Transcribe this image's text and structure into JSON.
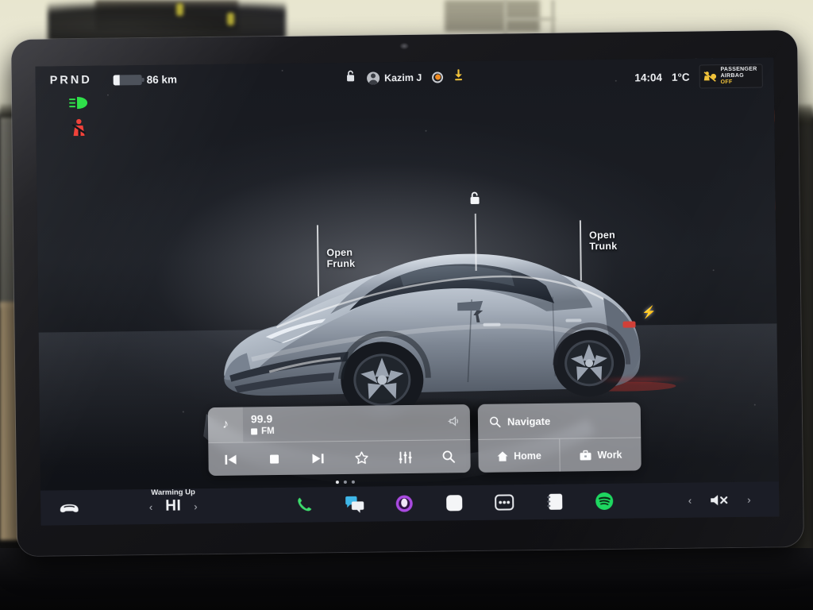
{
  "status_bar": {
    "gear_indicator": "PRND",
    "gear_active": "D",
    "range": "86 km",
    "battery_level_percent": 22,
    "telltales": [
      {
        "name": "low-beam-headlight",
        "color": "#2fe04a"
      },
      {
        "name": "seatbelt-reminder",
        "color": "#f0423a"
      }
    ],
    "lock_icon": "unlocked-padlock",
    "profile_name": "Kazim J",
    "dashcam_icon": "dashcam-record",
    "download_icon": "software-update-download",
    "clock": "14:04",
    "outside_temp": "1°C",
    "airbag": {
      "line1": "PASSENGER",
      "line2": "AIRBAG",
      "state": "OFF"
    }
  },
  "vehicle_view": {
    "callouts": [
      {
        "label": "Open\nFrunk",
        "name": "open-frunk"
      },
      {
        "label": "Open\nTrunk",
        "name": "open-trunk"
      }
    ],
    "lock_pin": "unlocked-padlock",
    "charge_port_icon": "charge-bolt",
    "model": "Tesla Model 3"
  },
  "map": {
    "position_marker": "navigation-arrow",
    "alert_markers": [
      "speed-alert",
      "speed-alert"
    ]
  },
  "media_card": {
    "source_icon": "music-note",
    "station": "99.9",
    "band": "FM",
    "volume_icon": "speaker",
    "controls": [
      {
        "name": "previous-track",
        "glyph": "previous"
      },
      {
        "name": "stop",
        "glyph": "stop"
      },
      {
        "name": "next-track",
        "glyph": "next"
      },
      {
        "name": "favorite",
        "glyph": "star"
      },
      {
        "name": "equalizer",
        "glyph": "sliders"
      },
      {
        "name": "search-media",
        "glyph": "search"
      }
    ]
  },
  "navigation_card": {
    "search_label": "Navigate",
    "search_icon": "search-icon",
    "shortcuts": [
      {
        "label": "Home",
        "icon": "home-icon"
      },
      {
        "label": "Work",
        "icon": "briefcase-icon"
      }
    ]
  },
  "page_dots": {
    "count": 3,
    "active_index": 0
  },
  "app_bar": {
    "car_icon": "car-front-icon",
    "climate": {
      "status": "Warming Up",
      "temperature": "HI",
      "decrease": "‹",
      "increase": "›"
    },
    "apps": [
      {
        "name": "phone",
        "color": "#3ddc6d"
      },
      {
        "name": "messages",
        "color": "#3fb7e8"
      },
      {
        "name": "media-player",
        "color": "#a94ae0"
      },
      {
        "name": "browser",
        "color": "#f4f5f7"
      },
      {
        "name": "more-apps",
        "color": "#e8eaee"
      },
      {
        "name": "notes",
        "color": "#f4f5f7"
      },
      {
        "name": "spotify",
        "color": "#1ed760"
      }
    ],
    "volume": {
      "decrease": "‹",
      "increase": "›",
      "state_icon": "volume-muted"
    }
  },
  "colors": {
    "screen_bg": "#14161c",
    "card_bg": "rgba(216,219,224,0.60)",
    "accent_amber": "#ef8b23",
    "warning_yellow": "#f0c23a",
    "telltale_green": "#2fe04a",
    "telltale_red": "#f0423a"
  }
}
